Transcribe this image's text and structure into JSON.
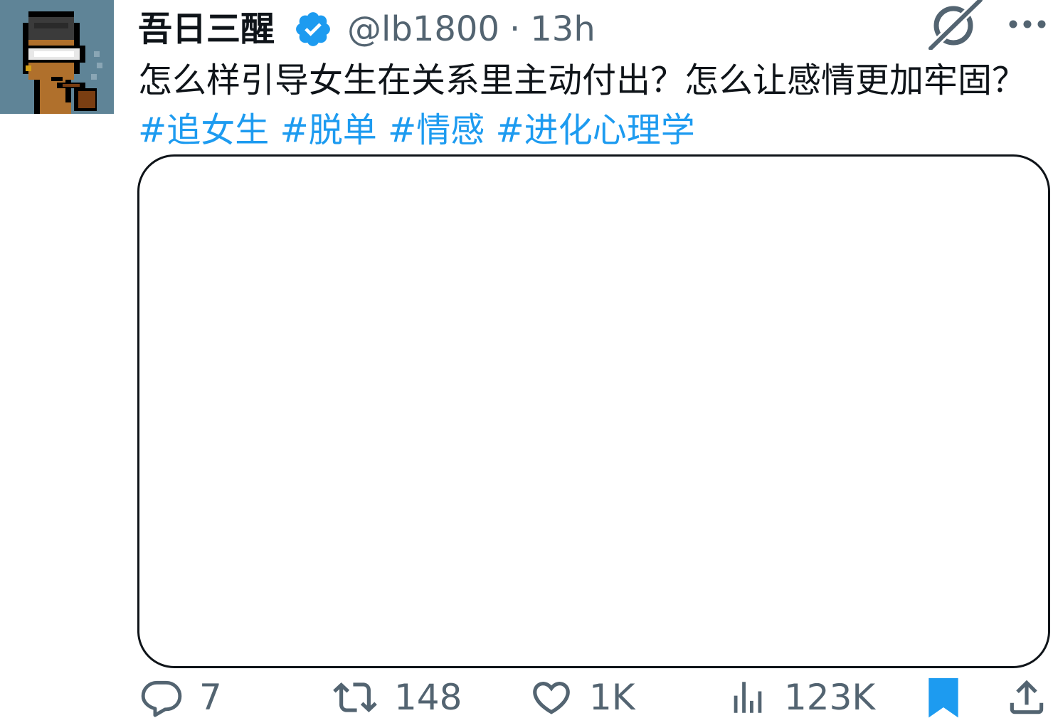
{
  "author": {
    "display_name": "吾日三醒",
    "handle": "@lb1800",
    "separator": "·",
    "time": "13h",
    "verified": true,
    "avatar_icon": "pixel-avatar-with-pipe"
  },
  "tweet": {
    "text": "怎么样引导女生在关系里主动付出？怎么让感情更加牢固？",
    "hashtags": [
      "#追女生",
      "#脱单",
      "#情感",
      "#进化心理学"
    ]
  },
  "header_icons": {
    "grok": "grok-icon",
    "more": "more-icon"
  },
  "actions": {
    "reply": {
      "icon": "reply-icon",
      "count": "7"
    },
    "retweet": {
      "icon": "retweet-icon",
      "count": "148"
    },
    "like": {
      "icon": "heart-icon",
      "count": "1K"
    },
    "views": {
      "icon": "views-icon",
      "count": "123K"
    },
    "bookmark": {
      "icon": "bookmark-icon"
    },
    "share": {
      "icon": "share-icon"
    }
  },
  "colors": {
    "text": "#0f1419",
    "muted": "#536471",
    "accent": "#1d9bf0",
    "avatar_bg": "#5f8497"
  }
}
